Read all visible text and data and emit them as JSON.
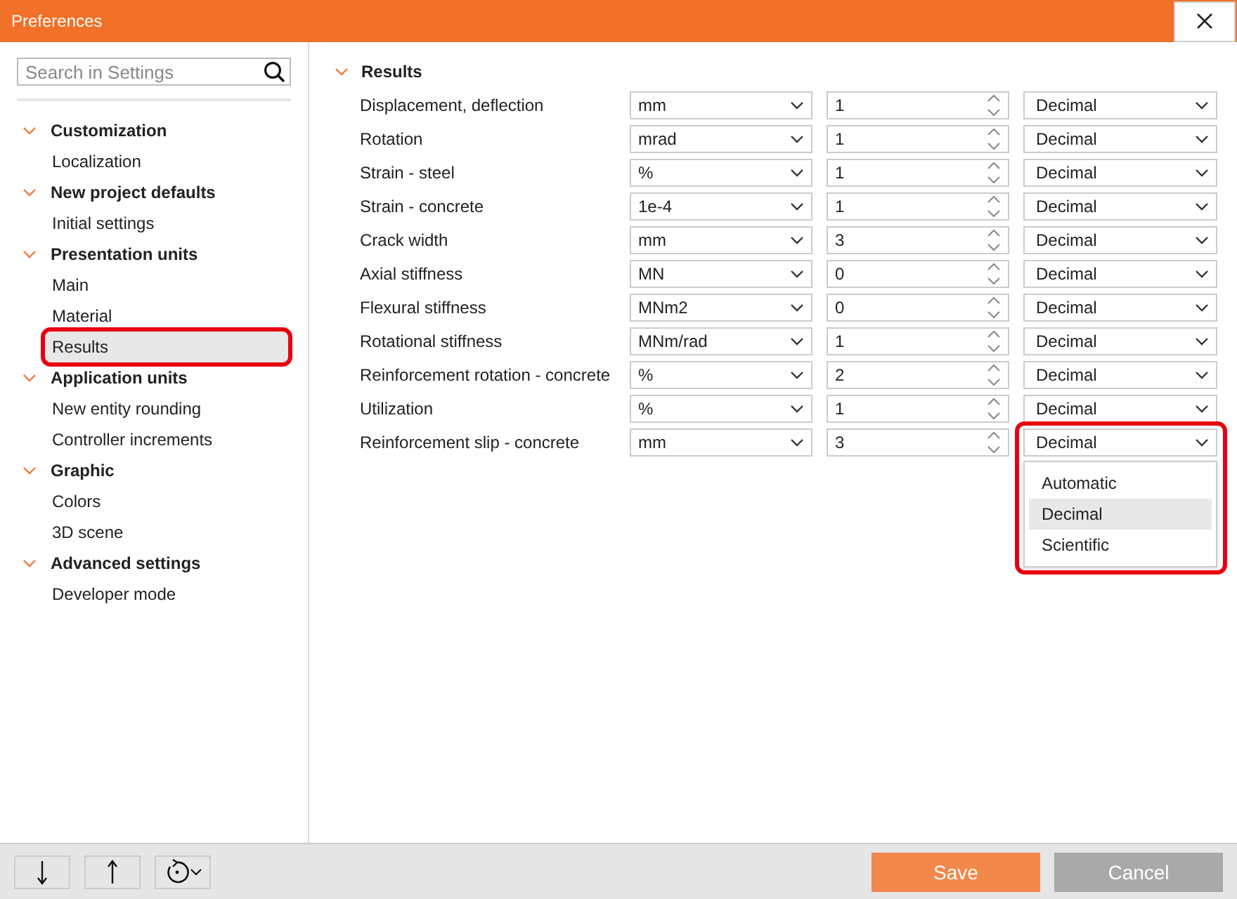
{
  "window": {
    "title": "Preferences"
  },
  "sidebar": {
    "search": {
      "placeholder": "Search in Settings"
    },
    "groups": [
      {
        "label": "Customization",
        "expanded": true,
        "children": [
          {
            "label": "Localization",
            "selected": false,
            "highlighted": false
          }
        ]
      },
      {
        "label": "New project defaults",
        "expanded": true,
        "children": [
          {
            "label": "Initial settings",
            "selected": false,
            "highlighted": false
          }
        ]
      },
      {
        "label": "Presentation units",
        "expanded": true,
        "children": [
          {
            "label": "Main",
            "selected": false,
            "highlighted": false
          },
          {
            "label": "Material",
            "selected": false,
            "highlighted": false
          },
          {
            "label": "Results",
            "selected": true,
            "highlighted": true
          }
        ]
      },
      {
        "label": "Application units",
        "expanded": true,
        "children": [
          {
            "label": "New entity rounding",
            "selected": false,
            "highlighted": false
          },
          {
            "label": "Controller increments",
            "selected": false,
            "highlighted": false
          }
        ]
      },
      {
        "label": "Graphic",
        "expanded": true,
        "children": [
          {
            "label": "Colors",
            "selected": false,
            "highlighted": false
          },
          {
            "label": "3D scene",
            "selected": false,
            "highlighted": false
          }
        ]
      },
      {
        "label": "Advanced settings",
        "expanded": true,
        "children": [
          {
            "label": "Developer mode",
            "selected": false,
            "highlighted": false
          }
        ]
      }
    ]
  },
  "section": {
    "title": "Results",
    "expanded": true,
    "rows": [
      {
        "label": "Displacement, deflection",
        "unit": "mm",
        "precision": "1",
        "format": "Decimal"
      },
      {
        "label": "Rotation",
        "unit": "mrad",
        "precision": "1",
        "format": "Decimal"
      },
      {
        "label": "Strain - steel",
        "unit": "%",
        "precision": "1",
        "format": "Decimal"
      },
      {
        "label": "Strain - concrete",
        "unit": "1e-4",
        "precision": "1",
        "format": "Decimal"
      },
      {
        "label": "Crack width",
        "unit": "mm",
        "precision": "3",
        "format": "Decimal"
      },
      {
        "label": "Axial stiffness",
        "unit": "MN",
        "precision": "0",
        "format": "Decimal"
      },
      {
        "label": "Flexural stiffness",
        "unit": "MNm2",
        "precision": "0",
        "format": "Decimal"
      },
      {
        "label": "Rotational stiffness",
        "unit": "MNm/rad",
        "precision": "1",
        "format": "Decimal"
      },
      {
        "label": "Reinforcement rotation - concrete",
        "unit": "%",
        "precision": "2",
        "format": "Decimal"
      },
      {
        "label": "Utilization",
        "unit": "%",
        "precision": "1",
        "format": "Decimal"
      },
      {
        "label": "Reinforcement slip - concrete",
        "unit": "mm",
        "precision": "3",
        "format": "Decimal",
        "highlighted": true,
        "open": true,
        "options": [
          {
            "label": "Automatic",
            "selected": false
          },
          {
            "label": "Decimal",
            "selected": true
          },
          {
            "label": "Scientific",
            "selected": false
          }
        ]
      }
    ]
  },
  "footer": {
    "buttons": [
      {
        "label": "Save",
        "kind": "primary"
      },
      {
        "label": "Cancel",
        "kind": "secondary"
      }
    ]
  }
}
